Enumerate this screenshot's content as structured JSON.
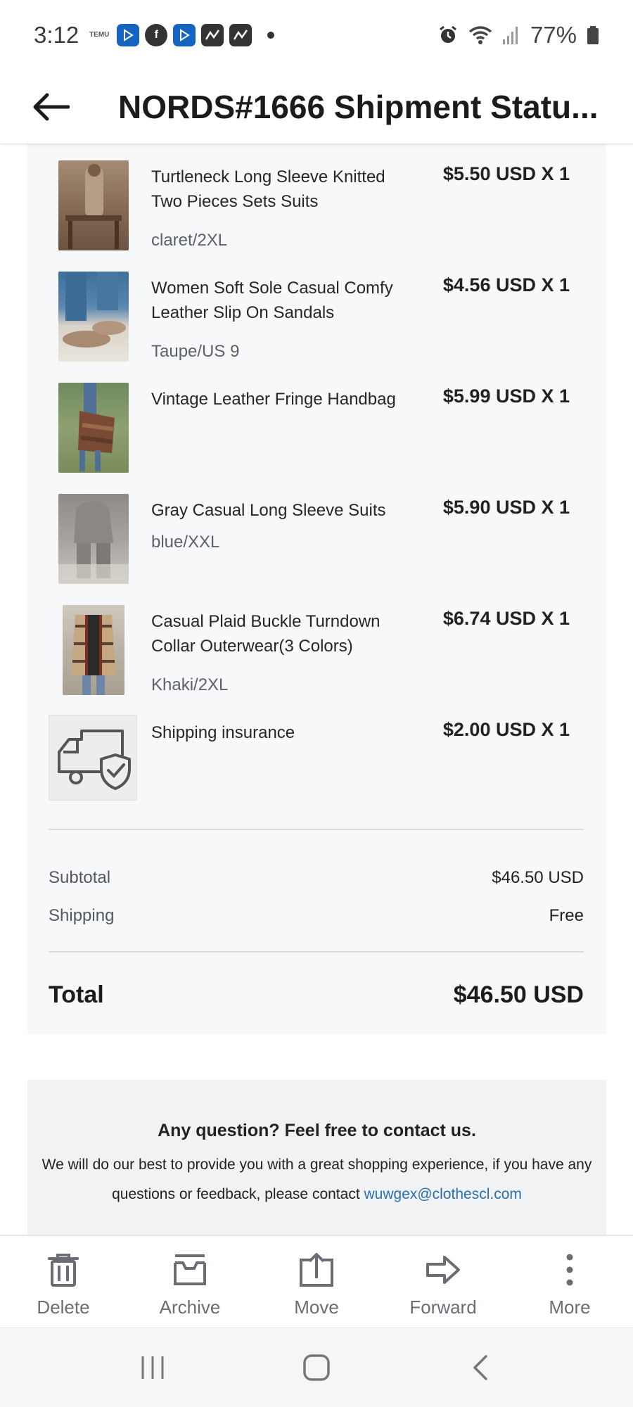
{
  "status_bar": {
    "time": "3:12",
    "temu_label": "TEMU",
    "battery_percent": "77%",
    "icons": [
      "temu-icon",
      "play-icon",
      "facebook-icon",
      "play-icon",
      "chart-app-icon",
      "chart-app-icon",
      "dot-icon",
      "alarm-icon",
      "wifi-icon",
      "signal-icon",
      "battery-icon"
    ]
  },
  "app_bar": {
    "title": "NORDS#1666 Shipment Statu..."
  },
  "order_items": [
    {
      "name": "Turtleneck Long Sleeve Knitted Two Pieces Sets Suits",
      "variant": "claret/2XL",
      "price": "$5.50 USD X 1"
    },
    {
      "name": "Women Soft Sole Casual Comfy Leather Slip On Sandals",
      "variant": "Taupe/US 9",
      "price": "$4.56 USD X 1"
    },
    {
      "name": "Vintage Leather Fringe Handbag",
      "variant": "",
      "price": "$5.99 USD X 1"
    },
    {
      "name": "Gray Casual Long Sleeve Suits",
      "variant": "blue/XXL",
      "price": "$5.90 USD X 1"
    },
    {
      "name": "Casual Plaid Buckle Turndown Collar Outerwear(3 Colors)",
      "variant": "Khaki/2XL",
      "price": "$6.74 USD X 1"
    },
    {
      "name": "Shipping insurance",
      "variant": "",
      "price": "$2.00 USD X 1"
    }
  ],
  "summary": {
    "subtotal_label": "Subtotal",
    "subtotal_value": "$46.50 USD",
    "shipping_label": "Shipping",
    "shipping_value": "Free",
    "total_label": "Total",
    "total_value": "$46.50 USD"
  },
  "contact": {
    "heading": "Any question? Feel free to contact us.",
    "body": "We will do our best to provide you with a great shopping experience, if you have any questions or feedback, please contact",
    "email": "wuwgex@clothescl.com"
  },
  "actions": {
    "delete": "Delete",
    "archive": "Archive",
    "move": "Move",
    "forward": "Forward",
    "more": "More"
  },
  "colors": {
    "card_background": "#f7f8fa",
    "link": "#2a6fb0",
    "action_label": "#6a6e74"
  }
}
